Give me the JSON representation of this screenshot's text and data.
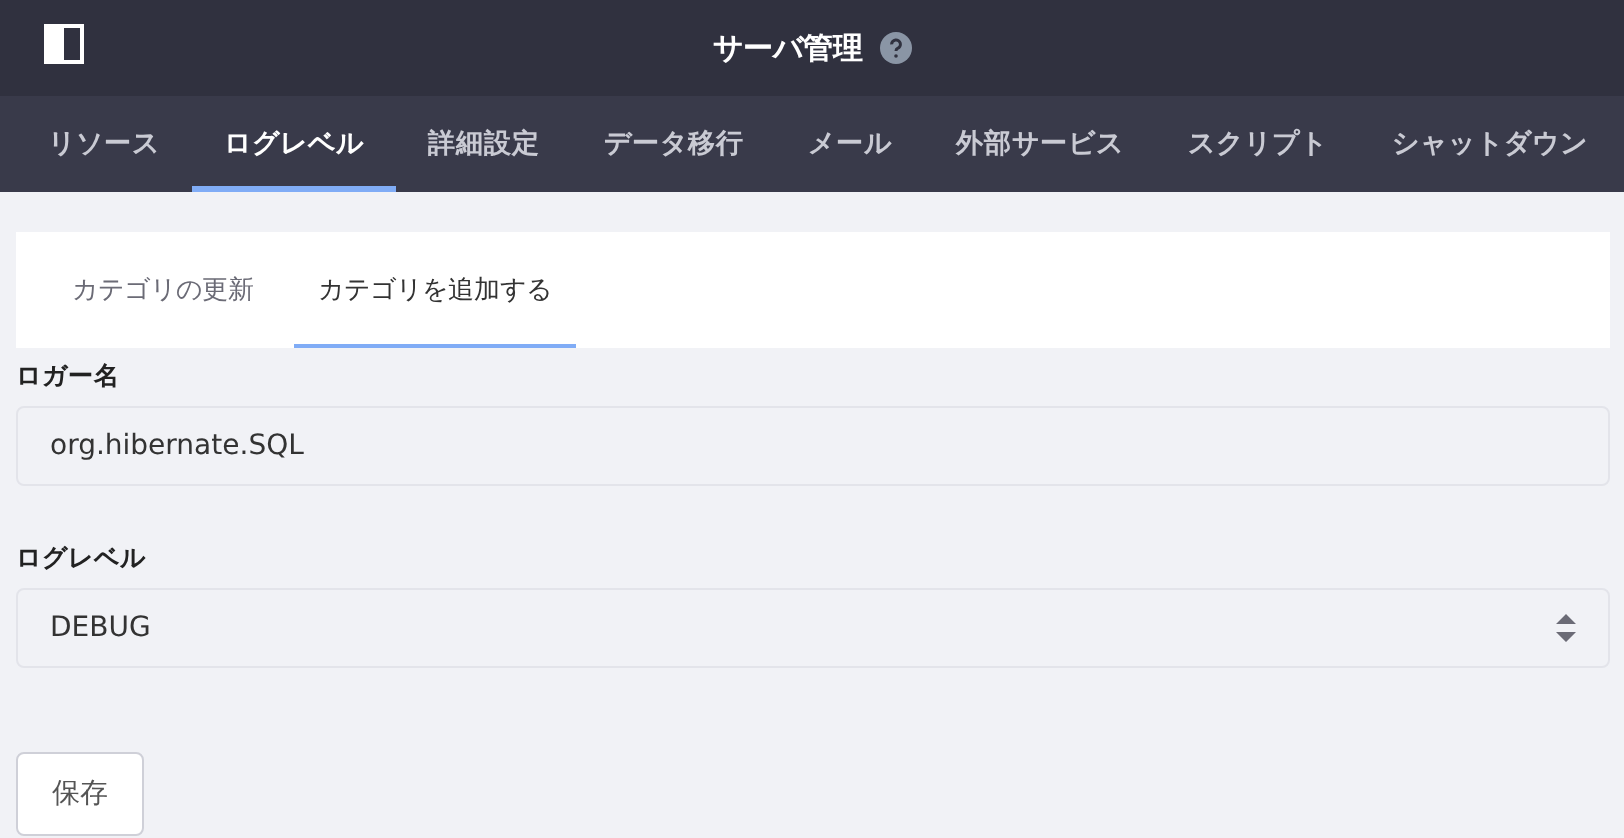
{
  "header": {
    "title": "サーバ管理"
  },
  "tabs": [
    {
      "label": "リソース",
      "selected": false
    },
    {
      "label": "ログレベル",
      "selected": true
    },
    {
      "label": "詳細設定",
      "selected": false
    },
    {
      "label": "データ移行",
      "selected": false
    },
    {
      "label": "メール",
      "selected": false
    },
    {
      "label": "外部サービス",
      "selected": false
    },
    {
      "label": "スクリプト",
      "selected": false
    },
    {
      "label": "シャットダウン",
      "selected": false
    }
  ],
  "subtabs": [
    {
      "label": "カテゴリの更新",
      "selected": false
    },
    {
      "label": "カテゴリを追加する",
      "selected": true
    }
  ],
  "form": {
    "logger_label": "ロガー名",
    "logger_value": "org.hibernate.SQL",
    "level_label": "ログレベル",
    "level_value": "DEBUG",
    "save_button": "保存"
  }
}
